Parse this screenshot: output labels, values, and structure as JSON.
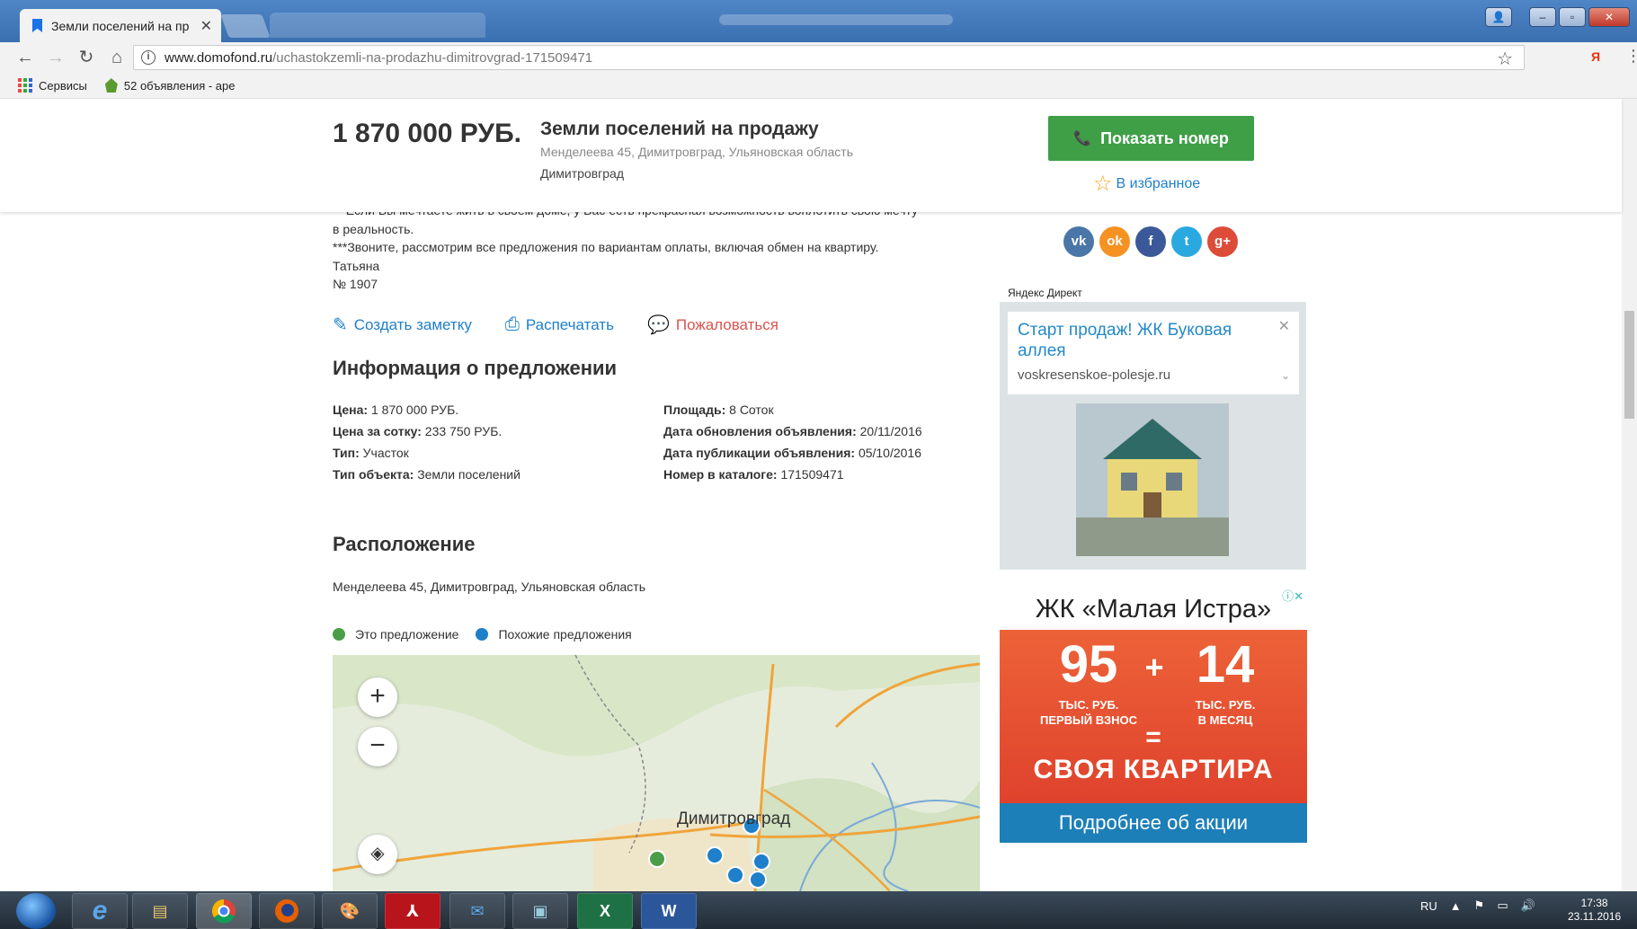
{
  "browser": {
    "tab_title": "Земли поселений на пр",
    "url_host": "www.domofond.ru",
    "url_path": "/uchastokzemli-na-prodazhu-dimitrovgrad-171509471",
    "bookmarks": [
      "Сервисы",
      "52 объявления - аре"
    ],
    "yandex_ext": "Я"
  },
  "header": {
    "price": "1 870 000 РУБ.",
    "title": "Земли поселений на продажу",
    "address": "Менделеева 45, Димитровград, Ульяновская область",
    "city": "Димитровград",
    "show_phone": "Показать номер",
    "favorite": "В избранное"
  },
  "description": {
    "line1": "** Если Вы мечтаете жить в своем доме, у Вас есть прекрасная возможность воплотить свою мечту",
    "line2": "в реальность.",
    "line3": "***Звоните, рассмотрим все предложения по вариантам оплаты, включая обмен на квартиру.",
    "line4": "Татьяна",
    "line5": "№ 1907"
  },
  "actions": {
    "note": "Создать заметку",
    "print": "Распечатать",
    "complain": "Пожаловаться"
  },
  "offer_info": {
    "heading": "Информация о предложении",
    "left": [
      {
        "label": "Цена:",
        "value": "1 870 000 РУБ."
      },
      {
        "label": "Цена за сотку:",
        "value": "233 750 РУБ."
      },
      {
        "label": "Тип:",
        "value": "Участок"
      },
      {
        "label": "Тип объекта:",
        "value": "Земли поселений"
      }
    ],
    "right": [
      {
        "label": "Площадь:",
        "value": "8 Соток"
      },
      {
        "label": "Дата обновления объявления:",
        "value": "20/11/2016"
      },
      {
        "label": "Дата публикации объявления:",
        "value": "05/10/2016"
      },
      {
        "label": "Номер в каталоге:",
        "value": "171509471"
      }
    ]
  },
  "location": {
    "heading": "Расположение",
    "address": "Менделеева 45, Димитровград, Ульяновская область",
    "legend_this": "Это предложение",
    "legend_similar": "Похожие предложения",
    "map_city": "Димитровград"
  },
  "social": [
    "vk",
    "ok",
    "f",
    "t",
    "g+"
  ],
  "ads": {
    "direct_label": "Яндекс Директ",
    "ad1_title": "Старт продаж! ЖК Буковая аллея",
    "ad1_domain": "voskresenskoe-polesje.ru",
    "ad2_title": "ЖК «Малая Истра»",
    "ad2_num1": "95",
    "ad2_cap1a": "ТЫС. РУБ.",
    "ad2_cap1b": "ПЕРВЫЙ ВЗНОС",
    "ad2_num2": "14",
    "ad2_cap2a": "ТЫС. РУБ.",
    "ad2_cap2b": "В МЕСЯЦ",
    "ad2_plus": "+",
    "ad2_eq": "=",
    "ad2_big": "СВОЯ КВАРТИРА",
    "ad2_button": "Подробнее об акции"
  },
  "taskbar": {
    "lang": "RU",
    "time": "17:38",
    "date": "23.11.2016"
  },
  "colors": {
    "accent_blue": "#1e7fcb",
    "phone_green": "#3e9f47",
    "complain_red": "#d9534f"
  }
}
